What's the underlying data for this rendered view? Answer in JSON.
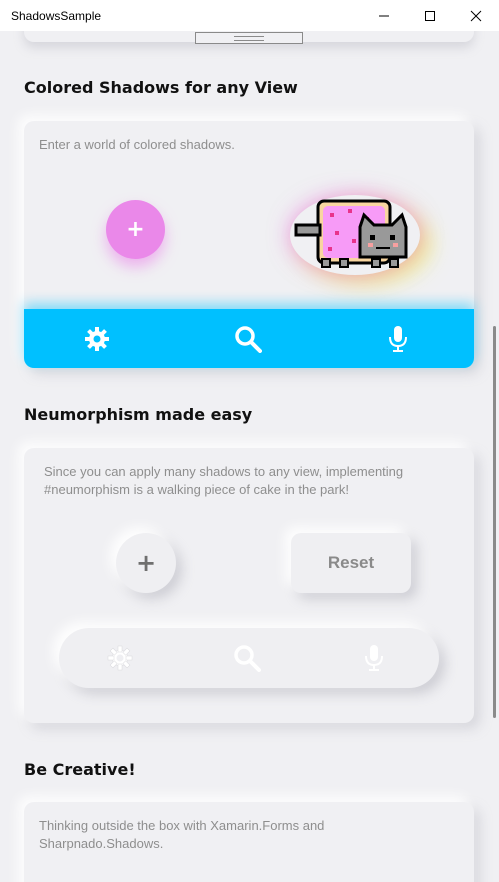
{
  "window": {
    "title": "ShadowsSample",
    "minimize_icon": "minimize-icon",
    "maximize_icon": "maximize-icon",
    "close_icon": "close-icon"
  },
  "sections": {
    "colored": {
      "title": "Colored Shadows for any View",
      "text": "Enter a world of colored shadows.",
      "plus_label": "+",
      "tabbar_color": "#00c0ff",
      "tabs": [
        "settings",
        "search",
        "microphone"
      ]
    },
    "neumorphism": {
      "title": "Neumorphism made easy",
      "text": "Since you can apply many shadows to any view, implementing #neumorphism is a walking piece of cake in the park!",
      "plus_label": "+",
      "reset_label": "Reset",
      "tabs": [
        "settings",
        "search",
        "microphone"
      ]
    },
    "creative": {
      "title": "Be Creative!",
      "text": "Thinking outside the box with Xamarin.Forms and Sharpnado.Shadows."
    }
  },
  "colors": {
    "pink": "#ea88e9",
    "blue": "#00c0ff",
    "background": "#f0f0f3"
  }
}
